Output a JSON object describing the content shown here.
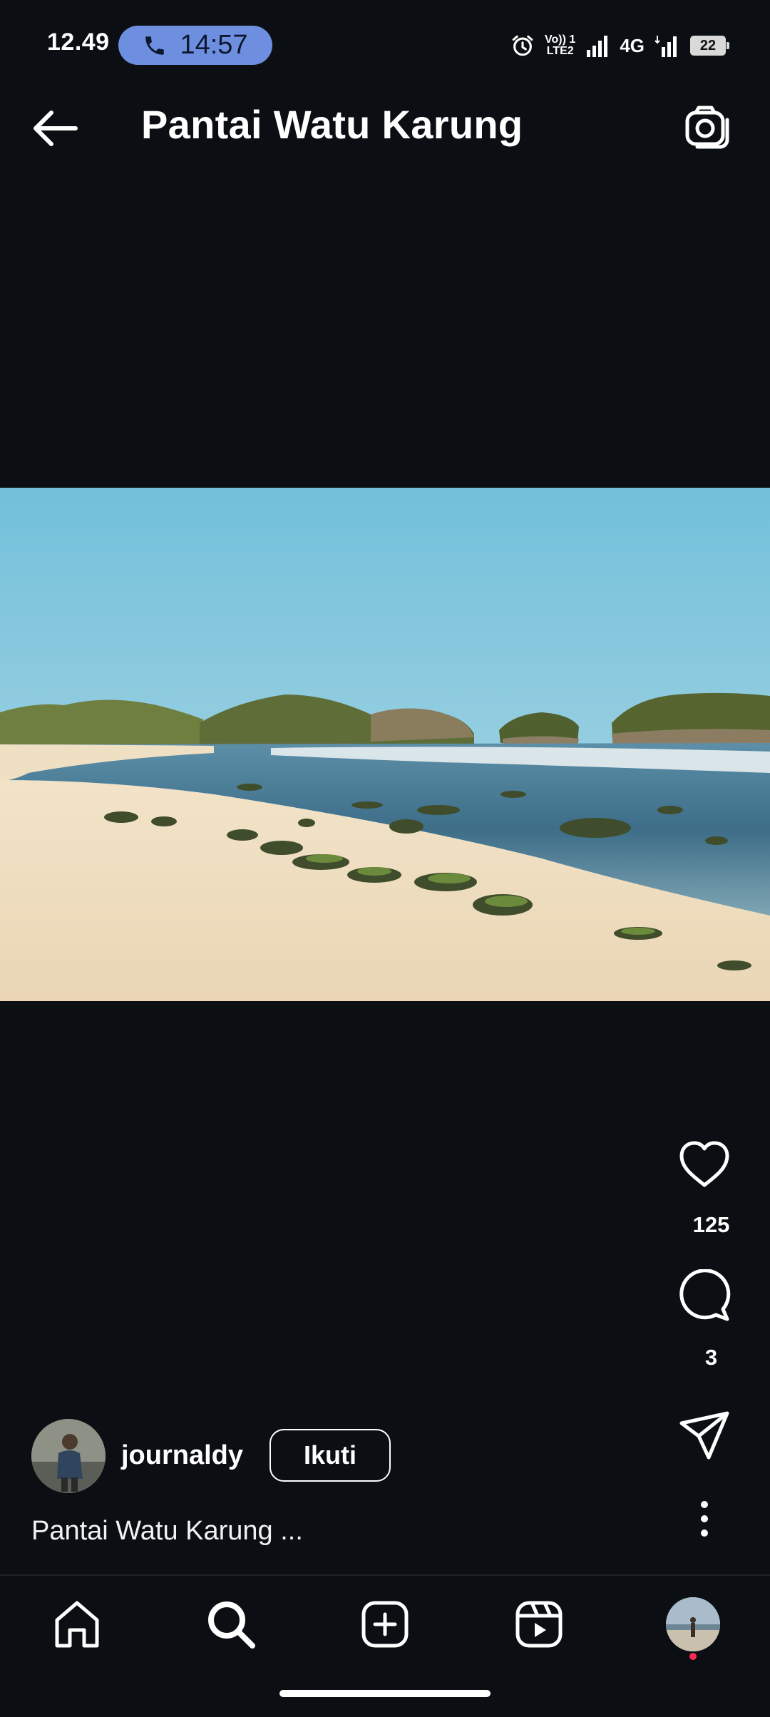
{
  "status_bar": {
    "time": "12.49",
    "call_duration": "14:57",
    "network_label_1": "Vo)) 1",
    "network_label_2": "LTE2",
    "network_type": "4G",
    "battery_level": "22",
    "icons": [
      "phone-icon",
      "alarm-icon",
      "signal-icon",
      "signal-icon",
      "battery-icon"
    ]
  },
  "header": {
    "title": "Pantai Watu Karung",
    "back_icon": "arrow-left-icon",
    "camera_icon": "camera-icon"
  },
  "post": {
    "likes": "125",
    "comments": "3",
    "author": "journaldy",
    "follow_label": "Ikuti",
    "caption": "Pantai Watu Karung ...",
    "action_icons": [
      "heart-icon",
      "comment-icon",
      "share-icon",
      "more-icon"
    ]
  },
  "nav": {
    "items": [
      "home-icon",
      "search-icon",
      "create-icon",
      "reels-icon",
      "profile-avatar"
    ],
    "active": "search-icon"
  },
  "colors": {
    "background": "#0b0e13",
    "call_pill": "#6e8fe0",
    "notification_dot": "#ff2a52",
    "text": "#ffffff"
  }
}
